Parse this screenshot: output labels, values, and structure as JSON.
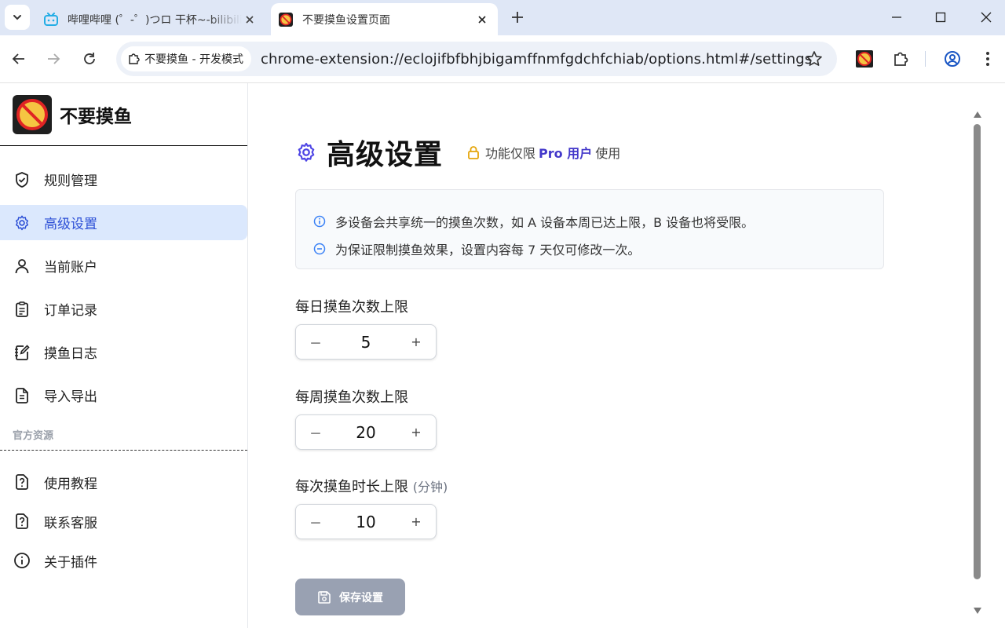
{
  "browser": {
    "tabs": [
      {
        "title": "哔哩哔哩 (゜-゜)つロ 干杯~-bilibili",
        "active": false,
        "favicon": "bilibili-icon"
      },
      {
        "title": "不要摸鱼设置页面",
        "active": true,
        "favicon": "extension-logo-icon"
      }
    ],
    "omnibox": {
      "chip_label": "不要摸鱼 - 开发模式",
      "url": "chrome-extension://eclojifbfbhjbigamffnmfgdchfchiab/options.html#/settings"
    }
  },
  "brand": {
    "name": "不要摸鱼"
  },
  "sidebar": {
    "items": [
      {
        "label": "规则管理",
        "icon": "shield-check-icon",
        "active": false
      },
      {
        "label": "高级设置",
        "icon": "gear-icon",
        "active": true
      },
      {
        "label": "当前账户",
        "icon": "user-icon",
        "active": false
      },
      {
        "label": "订单记录",
        "icon": "clipboard-list-icon",
        "active": false
      },
      {
        "label": "摸鱼日志",
        "icon": "notebook-pen-icon",
        "active": false
      },
      {
        "label": "导入导出",
        "icon": "file-text-icon",
        "active": false
      }
    ],
    "group_title": "官方资源",
    "resources": [
      {
        "label": "使用教程",
        "icon": "help-file-icon"
      },
      {
        "label": "联系客服",
        "icon": "help-file-icon"
      },
      {
        "label": "关于插件",
        "icon": "info-icon"
      }
    ]
  },
  "page": {
    "title": "高级设置",
    "pro_prefix": "功能仅限",
    "pro_badge": "Pro 用户",
    "pro_suffix": "使用",
    "notices": [
      "多设备会共享统一的摸鱼次数，如 A 设备本周已达上限，B 设备也将受限。",
      "为保证限制摸鱼效果，设置内容每 7 天仅可修改一次。"
    ],
    "fields": [
      {
        "label": "每日摸鱼次数上限",
        "unit": "",
        "value": "5"
      },
      {
        "label": "每周摸鱼次数上限",
        "unit": "",
        "value": "20"
      },
      {
        "label": "每次摸鱼时长上限",
        "unit": "(分钟)",
        "value": "10"
      }
    ],
    "stepper_minus": "－",
    "stepper_plus": "+",
    "save_label": "保存设置"
  },
  "colors": {
    "accent": "#4338ca",
    "active_bg": "#dbe8fd",
    "save_bg": "#99a1b2",
    "lock": "#e5a50a"
  }
}
